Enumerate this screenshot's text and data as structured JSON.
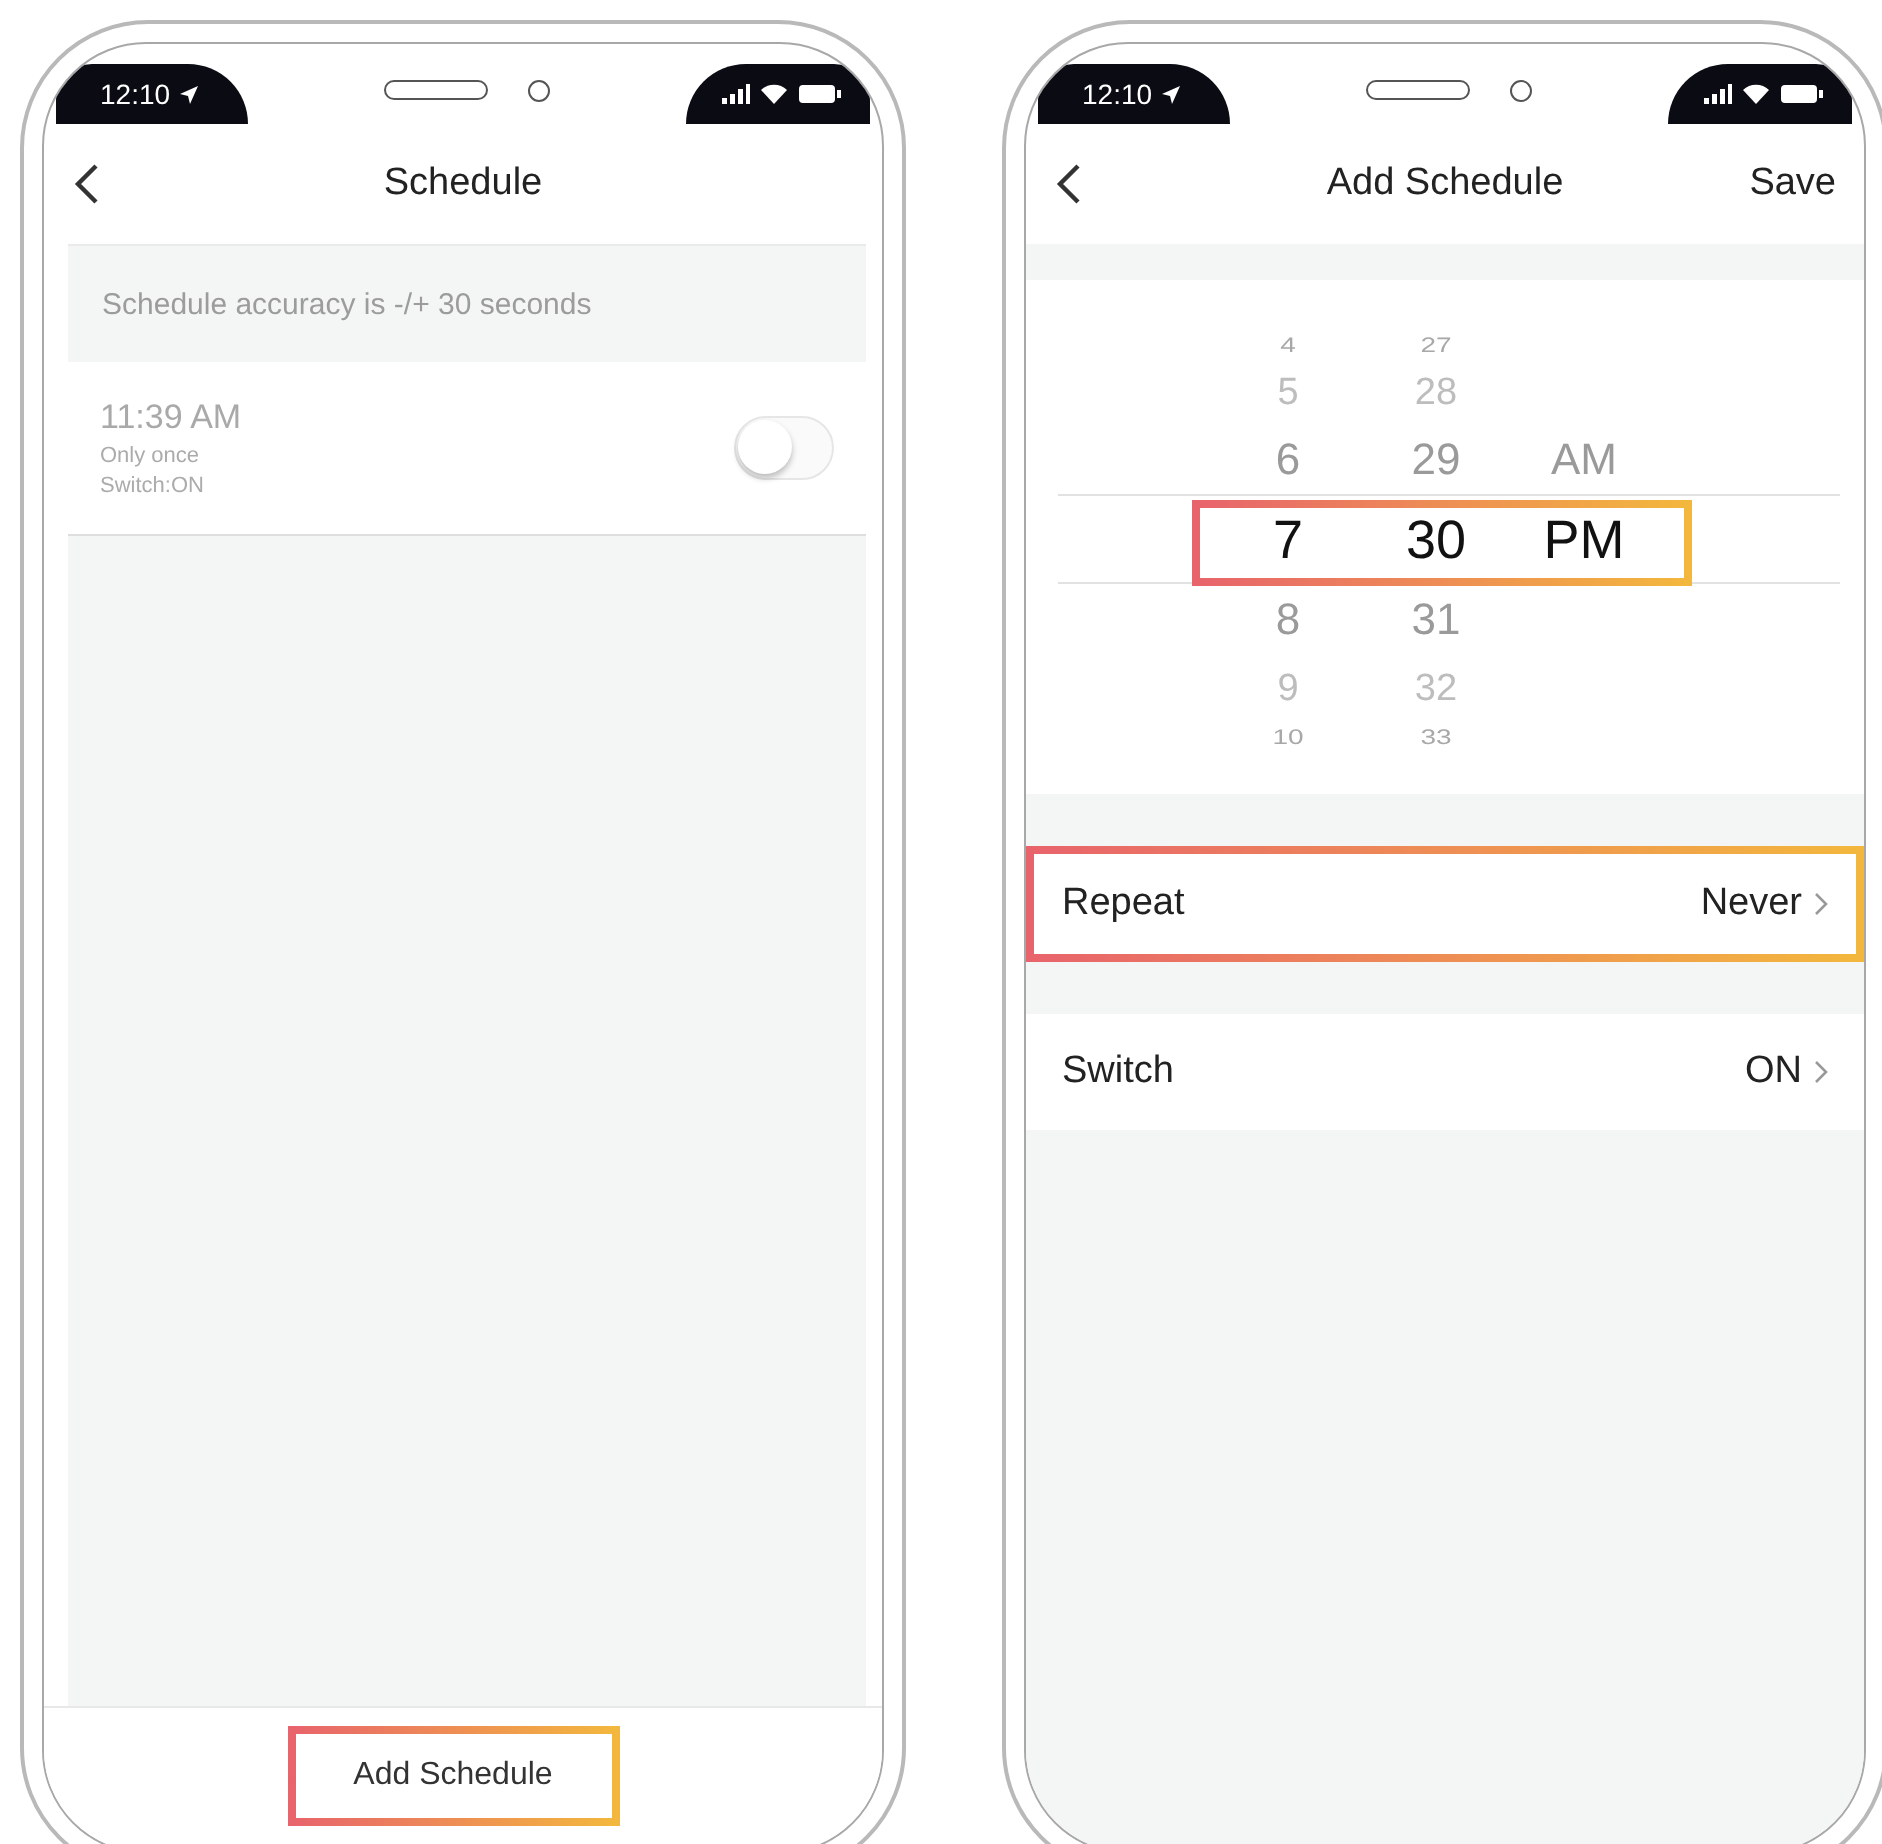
{
  "phones": [
    {
      "kind": "schedule_list",
      "status_bar": {
        "time": "12:10"
      },
      "nav": {
        "title": "Schedule"
      },
      "notice": "Schedule accuracy is -/+ 30 seconds",
      "schedules": [
        {
          "time": "11:39 AM",
          "repeat": "Only once",
          "action": "Switch:ON",
          "enabled": false
        }
      ],
      "add_button": {
        "label": "Add Schedule",
        "highlighted": true
      }
    },
    {
      "kind": "add_schedule",
      "status_bar": {
        "time": "12:10"
      },
      "nav": {
        "title": "Add Schedule",
        "action": "Save"
      },
      "picker": {
        "highlighted": true,
        "columns": [
          {
            "items": [
              {
                "label": "4",
                "selected": false
              },
              {
                "label": "5",
                "selected": false
              },
              {
                "label": "6",
                "selected": false
              },
              {
                "label": "7",
                "selected": true
              },
              {
                "label": "8",
                "selected": false
              },
              {
                "label": "9",
                "selected": false
              },
              {
                "label": "10",
                "selected": false
              }
            ]
          },
          {
            "items": [
              {
                "label": "27",
                "selected": false
              },
              {
                "label": "28",
                "selected": false
              },
              {
                "label": "29",
                "selected": false
              },
              {
                "label": "30",
                "selected": true
              },
              {
                "label": "31",
                "selected": false
              },
              {
                "label": "32",
                "selected": false
              },
              {
                "label": "33",
                "selected": false
              }
            ]
          },
          {
            "items": [
              {
                "label": "AM",
                "selected": false
              },
              {
                "label": "PM",
                "selected": true
              }
            ]
          }
        ]
      },
      "rows": [
        {
          "label": "Repeat",
          "value": "Never",
          "highlighted": true
        },
        {
          "label": "Switch",
          "value": "ON",
          "highlighted": false
        }
      ]
    }
  ]
}
